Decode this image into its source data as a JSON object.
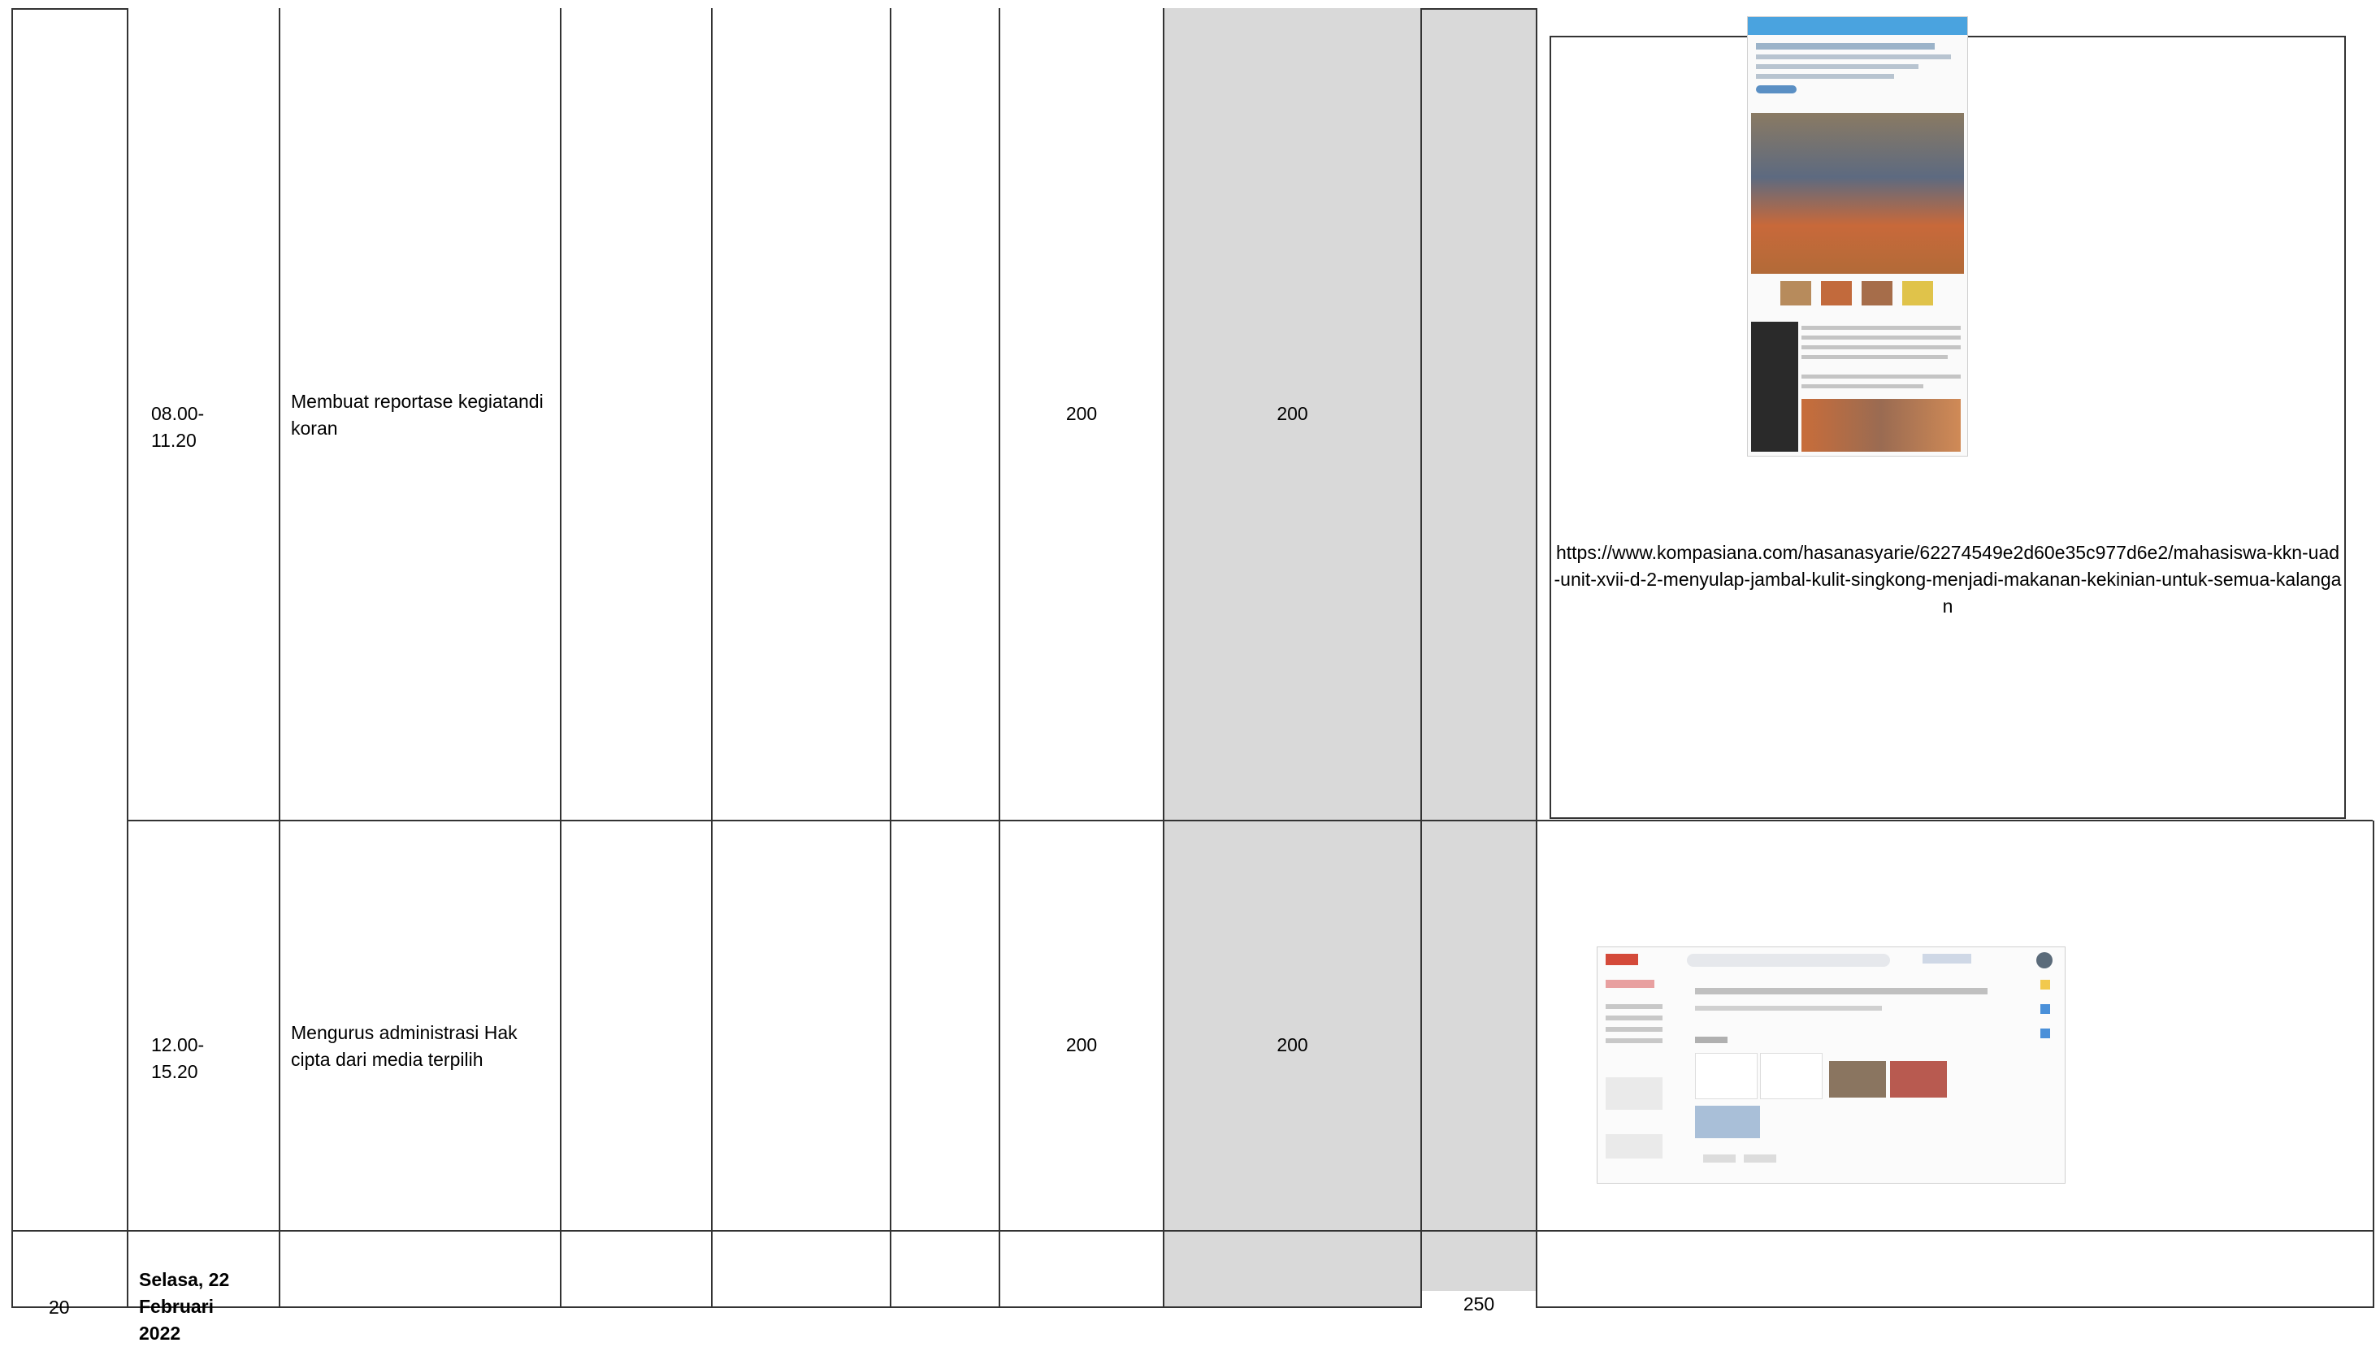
{
  "rows": [
    {
      "time": "08.00-\n11.20",
      "activity": "Membuat reportase kegiatandi koran",
      "value_a": "200",
      "value_b": "200",
      "evidence_url": "https://www.kompasiana.com/hasanasyarie/62274549e2d60e35c977d6e2/mahasiswa-kkn-uad-unit-xvii-d-2-menyulap-jambal-kulit-singkong-menjadi-makanan-kekinian-untuk-semua-kalangan"
    },
    {
      "time": "12.00-\n15.20",
      "activity": "Mengurus administrasi Hak cipta dari media terpilih",
      "value_a": "200",
      "value_b": "200"
    }
  ],
  "next_row": {
    "number": "20",
    "date": "Selasa, 22\nFebruari\n2022",
    "total": "250"
  },
  "colors": {
    "grid": "#333333",
    "shaded_column": "#d9d9d9"
  }
}
